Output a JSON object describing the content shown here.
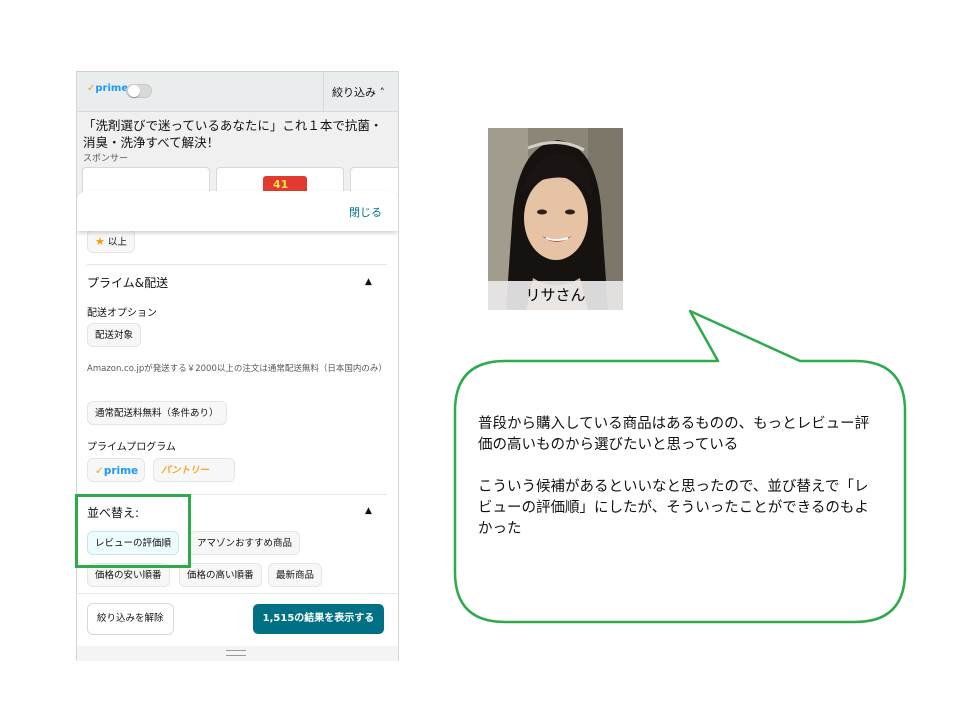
{
  "colors": {
    "accent_teal": "#007185",
    "highlight_green": "#2eaa4a",
    "star_orange": "#ff9900",
    "prime_blue": "#1a98ff"
  },
  "topbar": {
    "prime_label": "prime",
    "prime_toggle_on": false,
    "refine_label": "絞り込み ˄"
  },
  "sponsored": {
    "title": "「洗剤選びで迷っているあなたに」これ１本で抗菌・消臭・洗浄すべて解決！",
    "label": "スポンサー",
    "badge_number": "41"
  },
  "sheet": {
    "close_label": "閉じる",
    "rating_chip": "以上",
    "prime_delivery": {
      "title": "プライム&配送",
      "delivery_options_label": "配送オプション",
      "delivery_chip": "配送対象",
      "note": "Amazon.co.jpが発送する￥2000以上の注文は通常配送無料（日本国内のみ）",
      "free_shipping_chip": "通常配送料無料（条件あり）",
      "prime_program_label": "プライムプログラム",
      "prime_chip": "prime",
      "pantry_chip": "パントリー"
    },
    "sort": {
      "title": "並べ替え:",
      "options": [
        "レビューの評価順",
        "アマゾンおすすめ商品",
        "価格の安い順番",
        "価格の高い順番",
        "最新商品"
      ],
      "selected": "レビューの評価順"
    },
    "footer": {
      "clear_label": "絞り込みを解除",
      "show_results_label": "1,515の結果を表示する"
    }
  },
  "persona": {
    "name": "リサさん"
  },
  "comment": {
    "paragraph1": "普段から購入している商品はあるものの、もっとレビュー評価の高いものから選びたいと思っている",
    "paragraph2": "こういう候補があるといいなと思ったので、並び替えで「レビューの評価順」にしたが、そういったことができるのもよかった"
  }
}
